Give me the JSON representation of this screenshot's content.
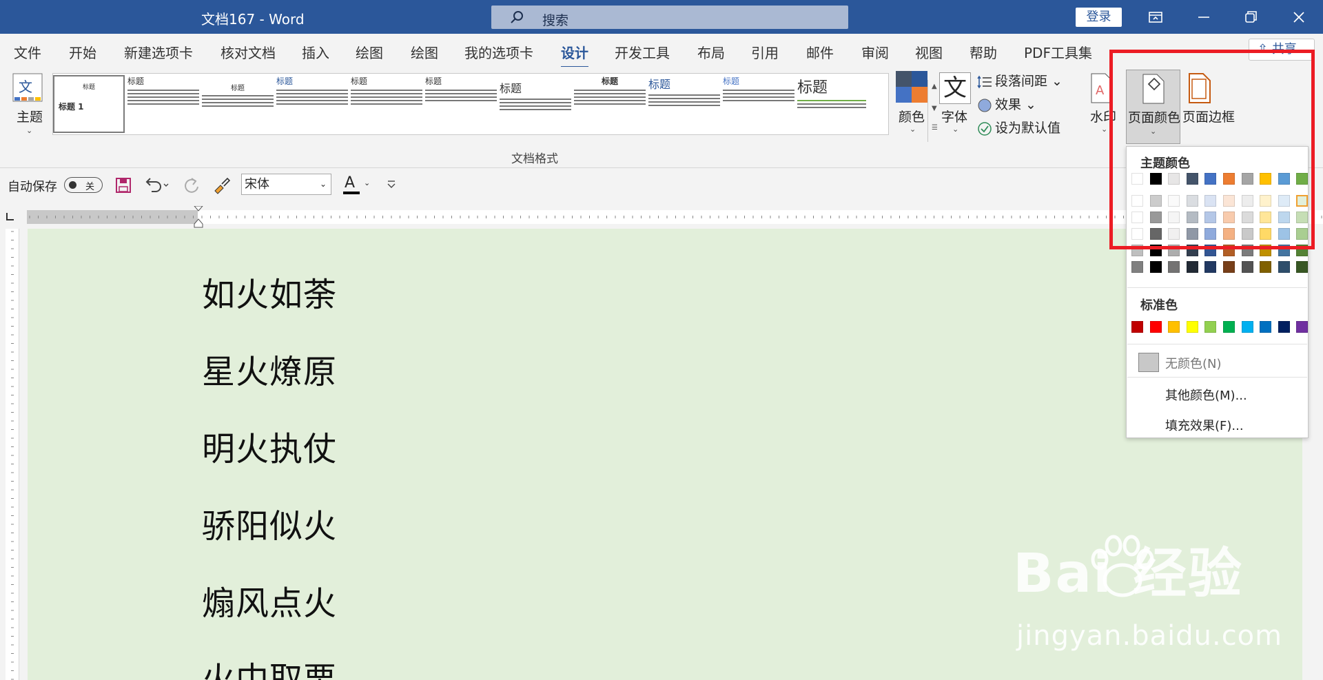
{
  "window": {
    "title": "文档167  -  Word",
    "login_label": "登录"
  },
  "search": {
    "placeholder": "搜索"
  },
  "tabs": [
    {
      "label": "文件"
    },
    {
      "label": "开始"
    },
    {
      "label": "新建选项卡"
    },
    {
      "label": "核对文档"
    },
    {
      "label": "插入"
    },
    {
      "label": "绘图"
    },
    {
      "label": "绘图"
    },
    {
      "label": "我的选项卡"
    },
    {
      "label": "设计"
    },
    {
      "label": "开发工具"
    },
    {
      "label": "布局"
    },
    {
      "label": "引用"
    },
    {
      "label": "邮件"
    },
    {
      "label": "审阅"
    },
    {
      "label": "视图"
    },
    {
      "label": "帮助"
    },
    {
      "label": "PDF工具集"
    }
  ],
  "active_tab": "设计",
  "share_label": "共享",
  "ribbon": {
    "theme_label": "主题",
    "group_label": "文档格式",
    "style_titles": [
      "标题 1",
      "标题",
      "标题",
      "标题",
      "标题",
      "标题",
      "标题",
      "标题",
      "标题",
      "标题",
      "标题"
    ],
    "colors_label": "颜色",
    "fonts_label": "字体",
    "font_icon_char": "文",
    "paragraph_spacing_label": "段落间距",
    "effects_label": "效果",
    "set_default_label": "设为默认值",
    "watermark_label": "水印",
    "page_color_label": "页面颜色",
    "page_border_label": "页面边框"
  },
  "qat": {
    "autosave_label": "自动保存",
    "toggle_state": "关",
    "font_name": "宋体",
    "font_color_letter": "A"
  },
  "document": {
    "lines": [
      "如火如荼",
      "星火燎原",
      "明火执仗",
      "骄阳似火",
      "煽风点火",
      "火中取栗"
    ]
  },
  "page_color_menu": {
    "theme_colors_header": "主题颜色",
    "theme_colors": [
      "#ffffff",
      "#000000",
      "#e7e6e6",
      "#44546a",
      "#4472c4",
      "#ed7d31",
      "#a5a5a5",
      "#ffc000",
      "#5b9bd5",
      "#70ad47"
    ],
    "standard_colors_header": "标准色",
    "standard_colors": [
      "#c00000",
      "#ff0000",
      "#ffc000",
      "#ffff00",
      "#92d050",
      "#00b050",
      "#00b0f0",
      "#0070c0",
      "#002060",
      "#7030a0"
    ],
    "no_color_label": "无颜色(N)",
    "more_colors_label": "其他颜色(M)...",
    "fill_effects_label": "填充效果(F)..."
  },
  "watermark_brand": {
    "logo": "Bai 经验",
    "url": "jingyan.baidu.com"
  },
  "colors": {
    "title_bar": "#2b579a",
    "page_background": "#e2efda",
    "highlight": "#ec1c24"
  }
}
